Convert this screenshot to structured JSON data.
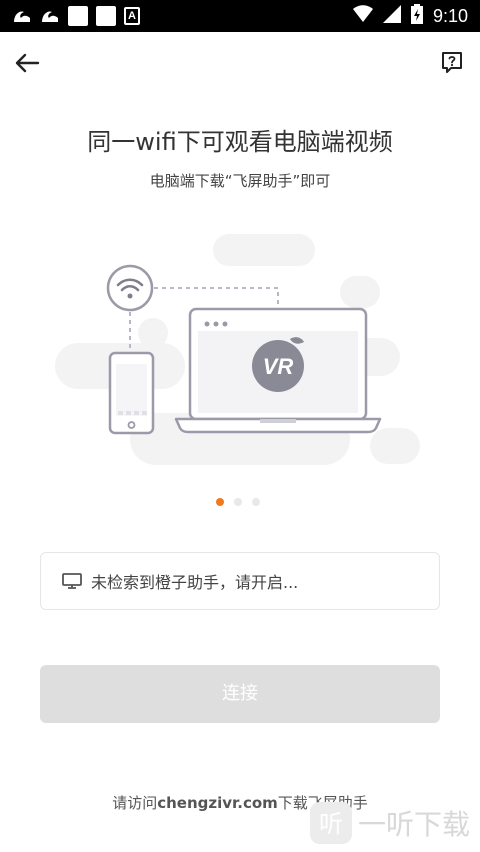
{
  "status_bar": {
    "time": "9:10",
    "app_icons": [
      "uc-browser-icon",
      "uc-browser-icon",
      "notification-box-icon",
      "notification-box-icon",
      "a-icon"
    ],
    "a_label": "A"
  },
  "header": {
    "title": "同一wifi下可观看电脑端视频",
    "subtitle": "电脑端下载“飞屏助手”即可"
  },
  "illustration": {
    "laptop_logo": "VR"
  },
  "pager": {
    "count": 3,
    "active": 0,
    "accent": "#f07a1c"
  },
  "search": {
    "status_text": "未检索到橙子助手，请开启..."
  },
  "connect_button": {
    "label": "连接"
  },
  "footer": {
    "prefix": "请访问",
    "domain": "chengzivr.com",
    "suffix": "下载飞屏助手"
  },
  "watermark": {
    "text": "一听下载"
  }
}
